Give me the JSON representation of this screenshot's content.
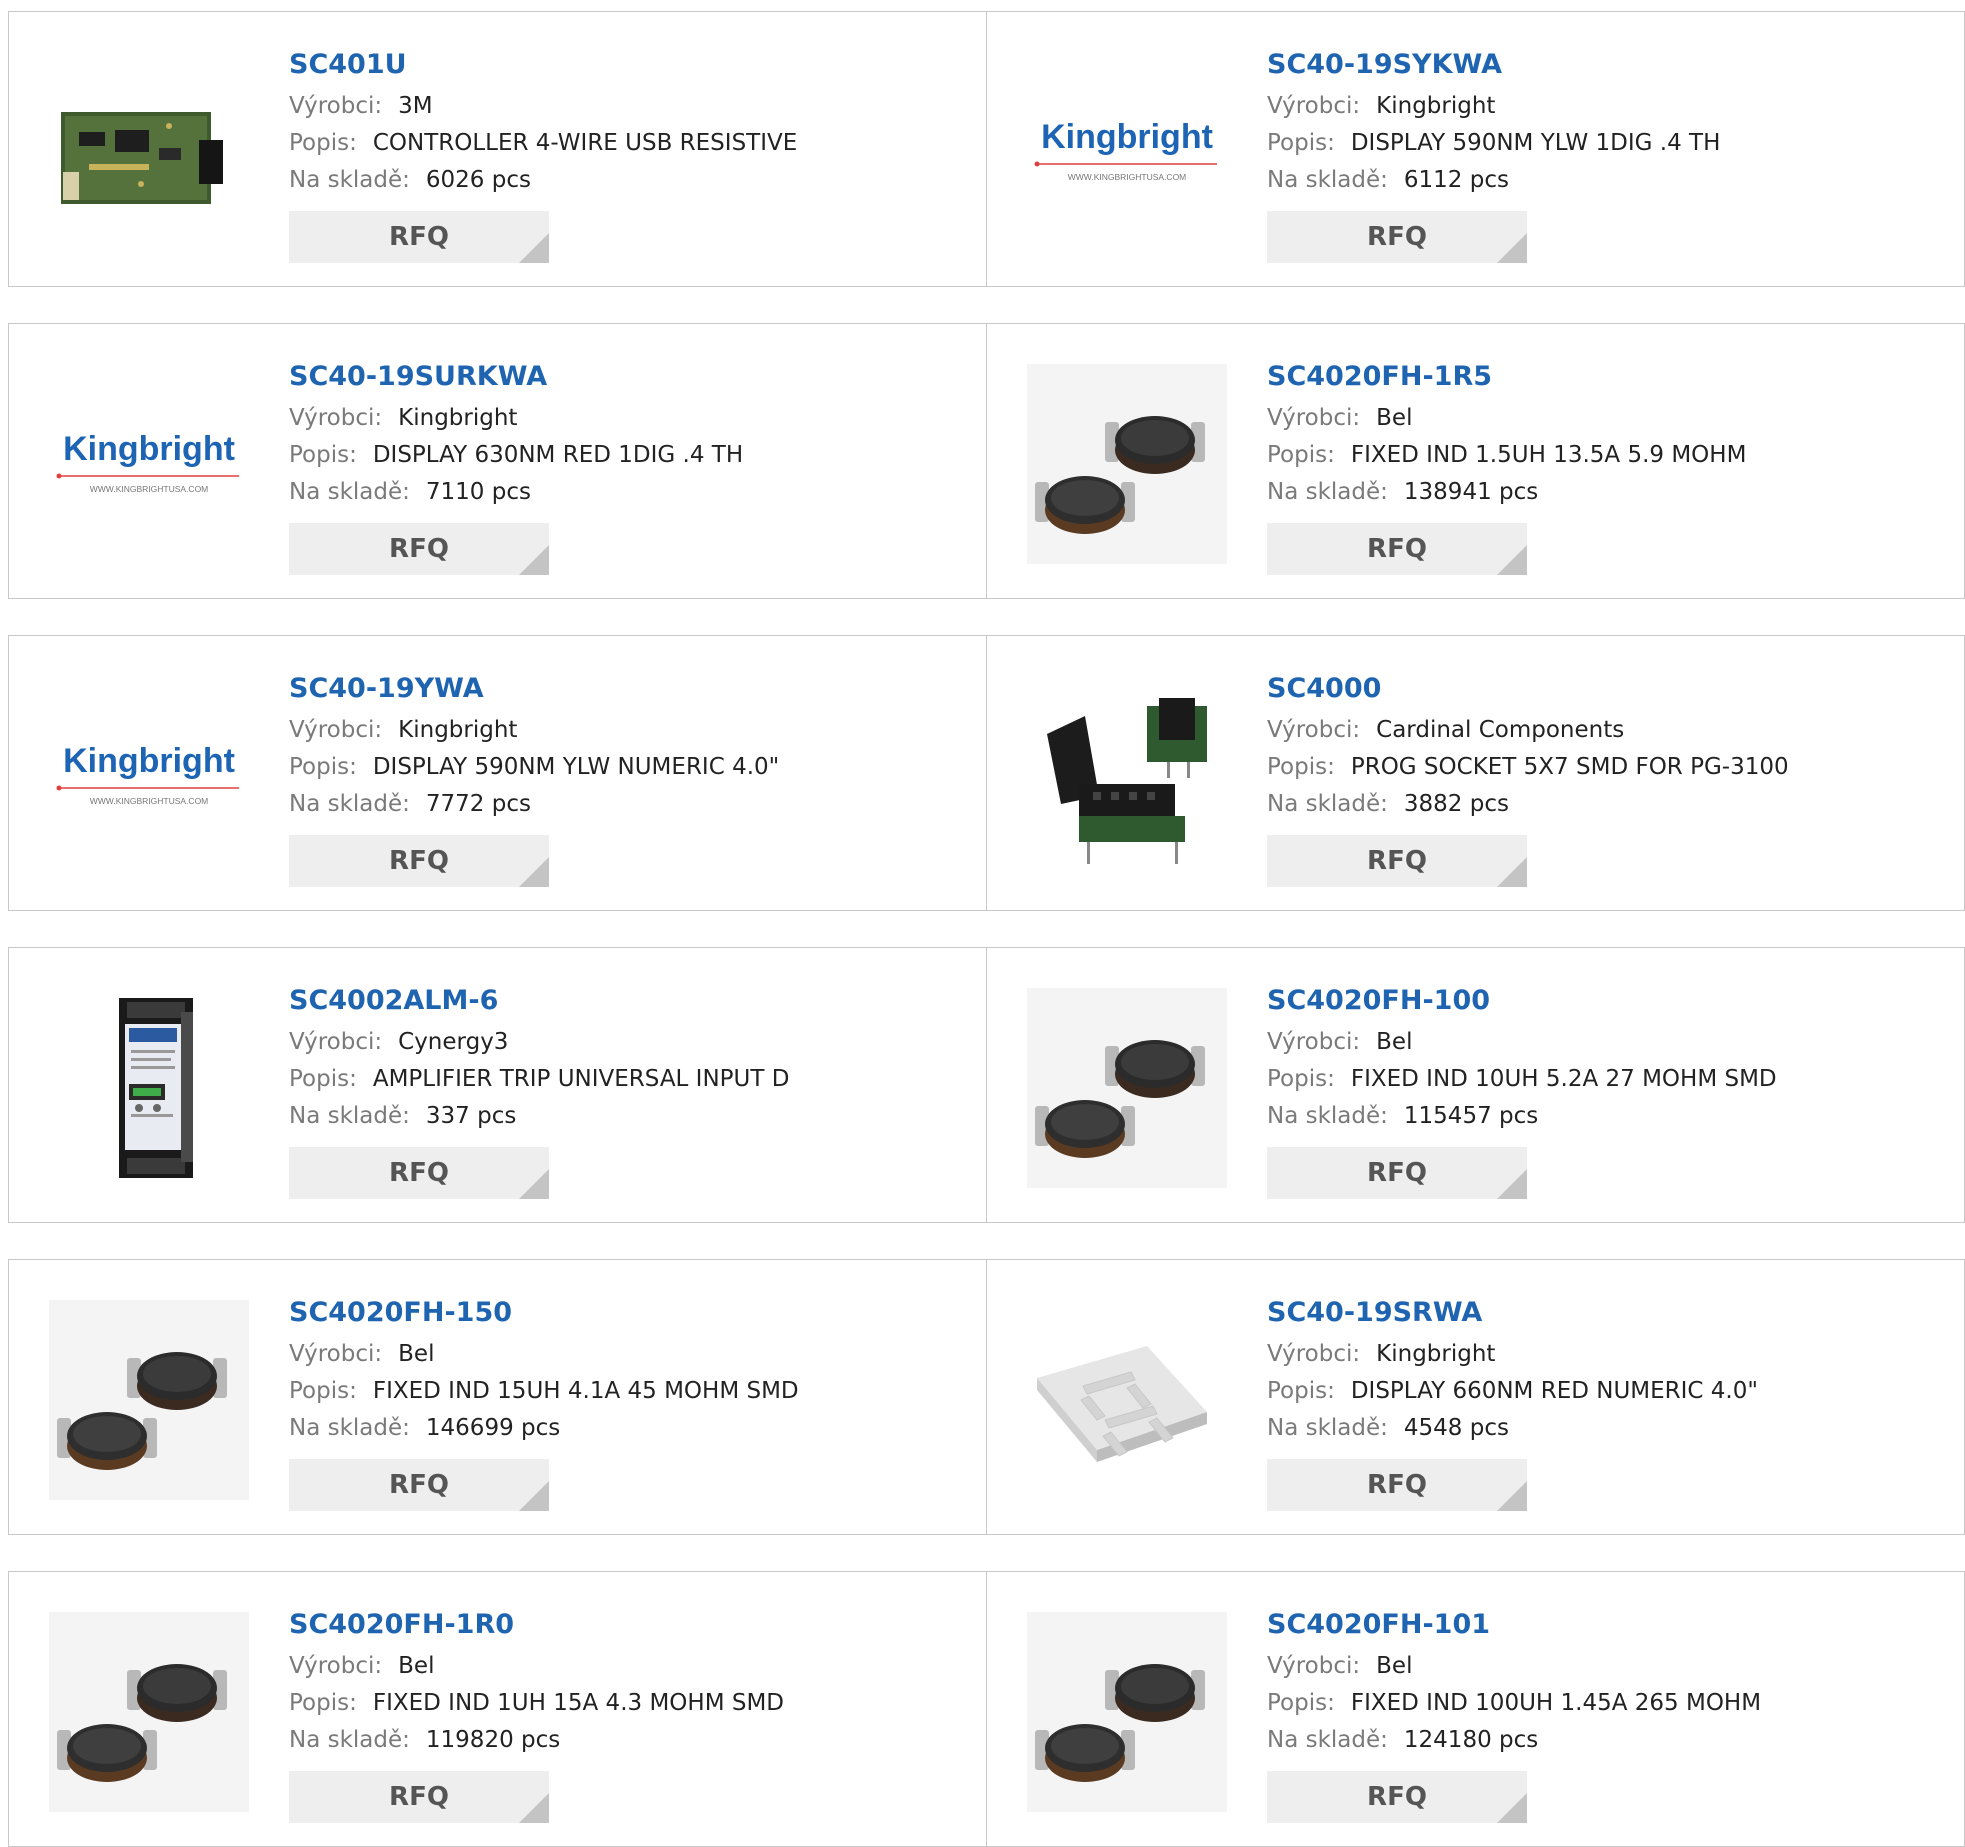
{
  "labels": {
    "manufacturer": "Výrobci:",
    "description": "Popis:",
    "stock": "Na skladě:",
    "rfq": "RFQ"
  },
  "colors": {
    "part_link": "#1f64b0",
    "label": "#7a7a7a",
    "rfq_bg": "#eeeeee"
  },
  "products": [
    {
      "part": "SC401U",
      "manufacturer": "3M",
      "description": "CONTROLLER 4-WIRE USB RESISTIVE",
      "stock": "6026 pcs",
      "image": "pcb-board"
    },
    {
      "part": "SC40-19SYKWA",
      "manufacturer": "Kingbright",
      "description": "DISPLAY 590NM YLW 1DIG .4 TH",
      "stock": "6112 pcs",
      "image": "kingbright-logo",
      "logo_text": "Kingbright",
      "logo_url": "WWW.KINGBRIGHTUSA.COM"
    },
    {
      "part": "SC40-19SURKWA",
      "manufacturer": "Kingbright",
      "description": "DISPLAY 630NM RED 1DIG .4 TH",
      "stock": "7110 pcs",
      "image": "kingbright-logo",
      "logo_text": "Kingbright",
      "logo_url": "WWW.KINGBRIGHTUSA.COM"
    },
    {
      "part": "SC4020FH-1R5",
      "manufacturer": "Bel",
      "description": "FIXED IND 1.5UH 13.5A 5.9 MOHM",
      "stock": "138941 pcs",
      "image": "inductors"
    },
    {
      "part": "SC40-19YWA",
      "manufacturer": "Kingbright",
      "description": "DISPLAY 590NM YLW NUMERIC 4.0\"",
      "stock": "7772 pcs",
      "image": "kingbright-logo",
      "logo_text": "Kingbright",
      "logo_url": "WWW.KINGBRIGHTUSA.COM"
    },
    {
      "part": "SC4000",
      "manufacturer": "Cardinal Components",
      "description": "PROG SOCKET 5X7 SMD FOR PG-3100",
      "stock": "3882 pcs",
      "image": "prog-socket"
    },
    {
      "part": "SC4002ALM-6",
      "manufacturer": "Cynergy3",
      "description": "AMPLIFIER TRIP UNIVERSAL INPUT D",
      "stock": "337 pcs",
      "image": "din-module"
    },
    {
      "part": "SC4020FH-100",
      "manufacturer": "Bel",
      "description": "FIXED IND 10UH 5.2A 27 MOHM SMD",
      "stock": "115457 pcs",
      "image": "inductors"
    },
    {
      "part": "SC4020FH-150",
      "manufacturer": "Bel",
      "description": "FIXED IND 15UH 4.1A 45 MOHM SMD",
      "stock": "146699 pcs",
      "image": "inductors"
    },
    {
      "part": "SC40-19SRWA",
      "manufacturer": "Kingbright",
      "description": "DISPLAY 660NM RED NUMERIC 4.0\"",
      "stock": "4548 pcs",
      "image": "seven-segment"
    },
    {
      "part": "SC4020FH-1R0",
      "manufacturer": "Bel",
      "description": "FIXED IND 1UH 15A 4.3 MOHM SMD",
      "stock": "119820 pcs",
      "image": "inductors"
    },
    {
      "part": "SC4020FH-101",
      "manufacturer": "Bel",
      "description": "FIXED IND 100UH 1.45A 265 MOHM",
      "stock": "124180 pcs",
      "image": "inductors"
    }
  ]
}
